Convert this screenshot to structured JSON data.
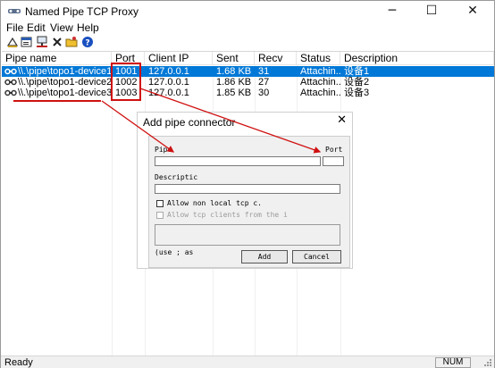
{
  "window": {
    "title": "Named Pipe TCP Proxy",
    "controls": {
      "minimize": "─",
      "maximize": "☐",
      "close": "✕"
    }
  },
  "menu": [
    "File",
    "Edit",
    "View",
    "Help"
  ],
  "toolbar": {
    "icons": [
      "new-pipe-icon",
      "properties-icon",
      "network-icon",
      "delete-icon",
      "folder-icon",
      "help-icon"
    ]
  },
  "table": {
    "headers": [
      "Pipe name",
      "Port",
      "Client IP",
      "Sent",
      "Recv",
      "Status",
      "Description"
    ],
    "rows": [
      {
        "pipe": "\\\\.\\pipe\\topo1-device1",
        "port": "1001",
        "ip": "127.0.0.1",
        "sent": "1.68 KB",
        "recv": "31",
        "status": "Attachin...",
        "desc": "设备1",
        "selected": true
      },
      {
        "pipe": "\\\\.\\pipe\\topo1-device2",
        "port": "1002",
        "ip": "127.0.0.1",
        "sent": "1.86 KB",
        "recv": "27",
        "status": "Attachin...",
        "desc": "设备2",
        "selected": false
      },
      {
        "pipe": "\\\\.\\pipe\\topo1-device3",
        "port": "1003",
        "ip": "127.0.0.1",
        "sent": "1.85 KB",
        "recv": "30",
        "status": "Attachin...",
        "desc": "设备3",
        "selected": false
      }
    ]
  },
  "dialog": {
    "title": "Add pipe connector",
    "close": "✕",
    "pipe_label": "Pipe",
    "port_label": "Port",
    "pipe_value": "",
    "port_value": "",
    "description_label": "Descriptic",
    "description_value": "",
    "allow_nonlocal": "Allow non local tcp c.",
    "allow_tcp_clients": "Allow tcp clients from the i",
    "hint": "(use ; as",
    "add_button": "Add",
    "cancel_button": "Cancel"
  },
  "statusbar": {
    "text": "Ready",
    "num": "NUM"
  },
  "colors": {
    "selection": "#0078d7",
    "annotation": "#d01010"
  }
}
